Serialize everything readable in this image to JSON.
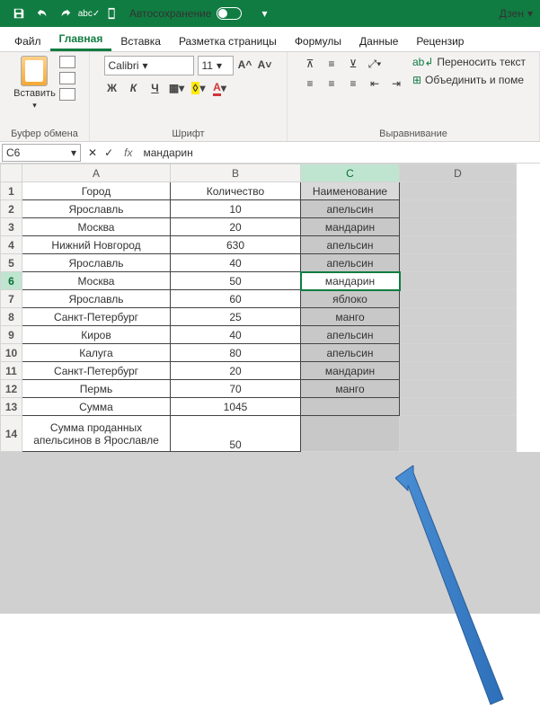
{
  "titlebar": {
    "autosave_label": "Автосохранение",
    "dzen_label": "Дзен"
  },
  "tabs": {
    "file": "Файл",
    "home": "Главная",
    "insert": "Вставка",
    "layout": "Разметка страницы",
    "formulas": "Формулы",
    "data": "Данные",
    "review": "Рецензир"
  },
  "ribbon": {
    "paste_label": "Вставить",
    "clipboard_group": "Буфер обмена",
    "font_name": "Calibri",
    "font_size": "11",
    "font_group": "Шрифт",
    "bold": "Ж",
    "italic": "К",
    "underline": "Ч",
    "wrap_label": "Переносить текст",
    "merge_label": "Объединить и поме",
    "align_group": "Выравнивание"
  },
  "namebox": {
    "cell_ref": "C6",
    "formula": "мандарин"
  },
  "cols": {
    "a": "A",
    "b": "B",
    "c": "C",
    "d": "D"
  },
  "rows": [
    "1",
    "2",
    "3",
    "4",
    "5",
    "6",
    "7",
    "8",
    "9",
    "10",
    "11",
    "12",
    "13",
    "14"
  ],
  "header": {
    "city": "Город",
    "qty": "Количество",
    "name": "Наименование"
  },
  "data": [
    {
      "city": "Ярославль",
      "qty": "10",
      "name": "апельсин"
    },
    {
      "city": "Москва",
      "qty": "20",
      "name": "мандарин"
    },
    {
      "city": "Нижний Новгород",
      "qty": "630",
      "name": "апельсин"
    },
    {
      "city": "Ярославль",
      "qty": "40",
      "name": "апельсин"
    },
    {
      "city": "Москва",
      "qty": "50",
      "name": "мандарин"
    },
    {
      "city": "Ярославль",
      "qty": "60",
      "name": "яблоко"
    },
    {
      "city": "Санкт-Петербург",
      "qty": "25",
      "name": "манго"
    },
    {
      "city": "Киров",
      "qty": "40",
      "name": "апельсин"
    },
    {
      "city": "Калуга",
      "qty": "80",
      "name": "апельсин"
    },
    {
      "city": "Санкт-Петербург",
      "qty": "20",
      "name": "мандарин"
    },
    {
      "city": "Пермь",
      "qty": "70",
      "name": "манго"
    }
  ],
  "sum_row": {
    "label": "Сумма",
    "value": "1045"
  },
  "total_row": {
    "label": "Сумма проданных апельсинов в Ярославле",
    "value": "50"
  },
  "chart_data": {
    "type": "table",
    "columns": [
      "Город",
      "Количество",
      "Наименование"
    ],
    "rows": [
      [
        "Ярославль",
        10,
        "апельсин"
      ],
      [
        "Москва",
        20,
        "мандарин"
      ],
      [
        "Нижний Новгород",
        630,
        "апельсин"
      ],
      [
        "Ярославль",
        40,
        "апельсин"
      ],
      [
        "Москва",
        50,
        "мандарин"
      ],
      [
        "Ярославль",
        60,
        "яблоко"
      ],
      [
        "Санкт-Петербург",
        25,
        "манго"
      ],
      [
        "Киров",
        40,
        "апельсин"
      ],
      [
        "Калуга",
        80,
        "апельсин"
      ],
      [
        "Санкт-Петербург",
        20,
        "мандарин"
      ],
      [
        "Пермь",
        70,
        "манго"
      ],
      [
        "Сумма",
        1045,
        ""
      ],
      [
        "Сумма проданных апельсинов в Ярославле",
        50,
        ""
      ]
    ]
  }
}
